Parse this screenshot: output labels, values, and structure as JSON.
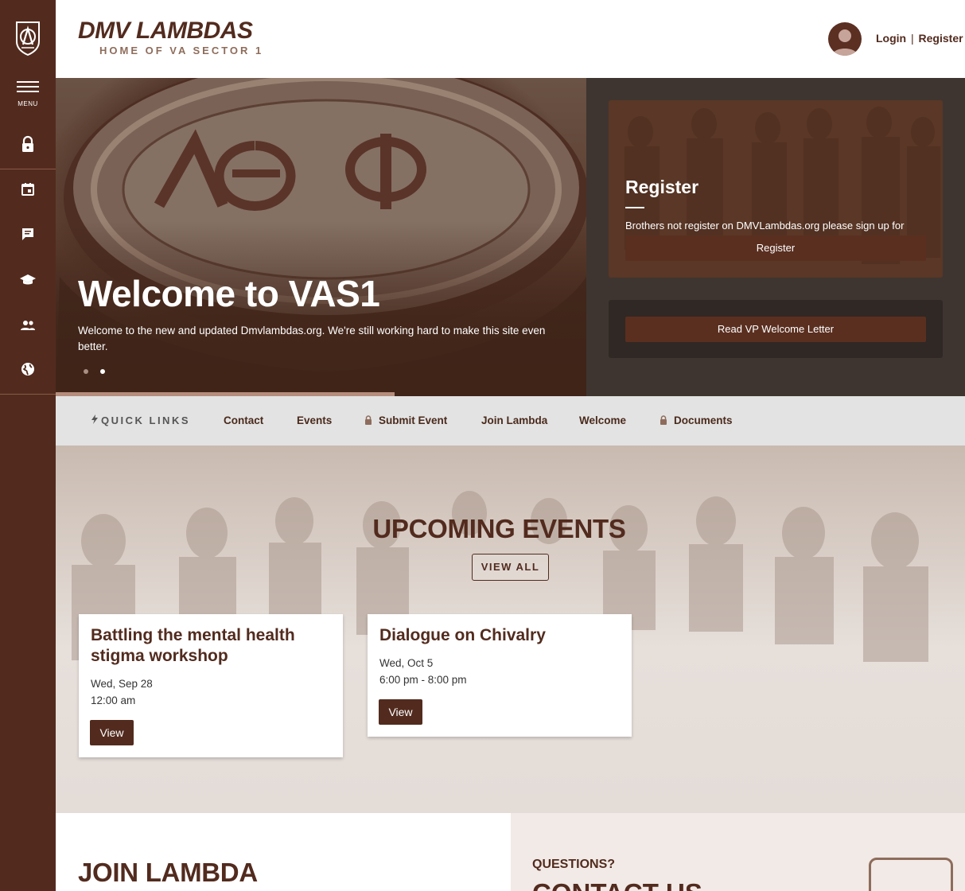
{
  "sidebar": {
    "logo_icon": "lambda-crest-icon",
    "menu_label": "MENU",
    "icons": [
      "lock-icon",
      "calendar-icon",
      "chat-icon",
      "graduation-cap-icon",
      "people-icon",
      "globe-icon"
    ]
  },
  "header": {
    "title": "DMV LAMBDAS",
    "subtitle": "HOME OF VA SECTOR 1",
    "login": "Login",
    "separator": "|",
    "register": "Register"
  },
  "hero": {
    "title": "Welcome to VAS1",
    "text": "Welcome to the new and updated Dmvlambdas.org. We're still working hard to make this site even better.",
    "slide_count": 2,
    "active_slide": 2
  },
  "register_card": {
    "title": "Register",
    "text": "Brothers not register on DMVLambdas.org please sign up for access to private pages on this website.",
    "button": "Register"
  },
  "vp_card": {
    "button": "Read VP Welcome Letter"
  },
  "quick_links": {
    "label": "QUICK LINKS",
    "items": [
      {
        "label": "Contact",
        "locked": false
      },
      {
        "label": "Events",
        "locked": false
      },
      {
        "label": "Submit Event",
        "locked": true
      },
      {
        "label": "Join Lambda",
        "locked": false
      },
      {
        "label": "Welcome",
        "locked": false
      },
      {
        "label": "Documents",
        "locked": true
      }
    ]
  },
  "events": {
    "title": "UPCOMING EVENTS",
    "view_all": "VIEW ALL",
    "items": [
      {
        "title": "Battling the mental health stigma workshop",
        "date": "Wed, Sep 28",
        "time": "12:00 am",
        "button": "View"
      },
      {
        "title": "Dialogue on Chivalry",
        "date": "Wed, Oct 5",
        "time": "6:00 pm - 8:00 pm",
        "button": "View"
      }
    ]
  },
  "join": {
    "title": "JOIN LAMBDA"
  },
  "contact": {
    "kicker": "QUESTIONS?",
    "title": "CONTACT US",
    "phone_icon": "phone-icon"
  },
  "colors": {
    "brand_brown": "#522b1e",
    "accent_tan": "#8e6c5b",
    "panel_dark": "#3e3530",
    "quicklinks_bg": "#e3e3e3"
  }
}
